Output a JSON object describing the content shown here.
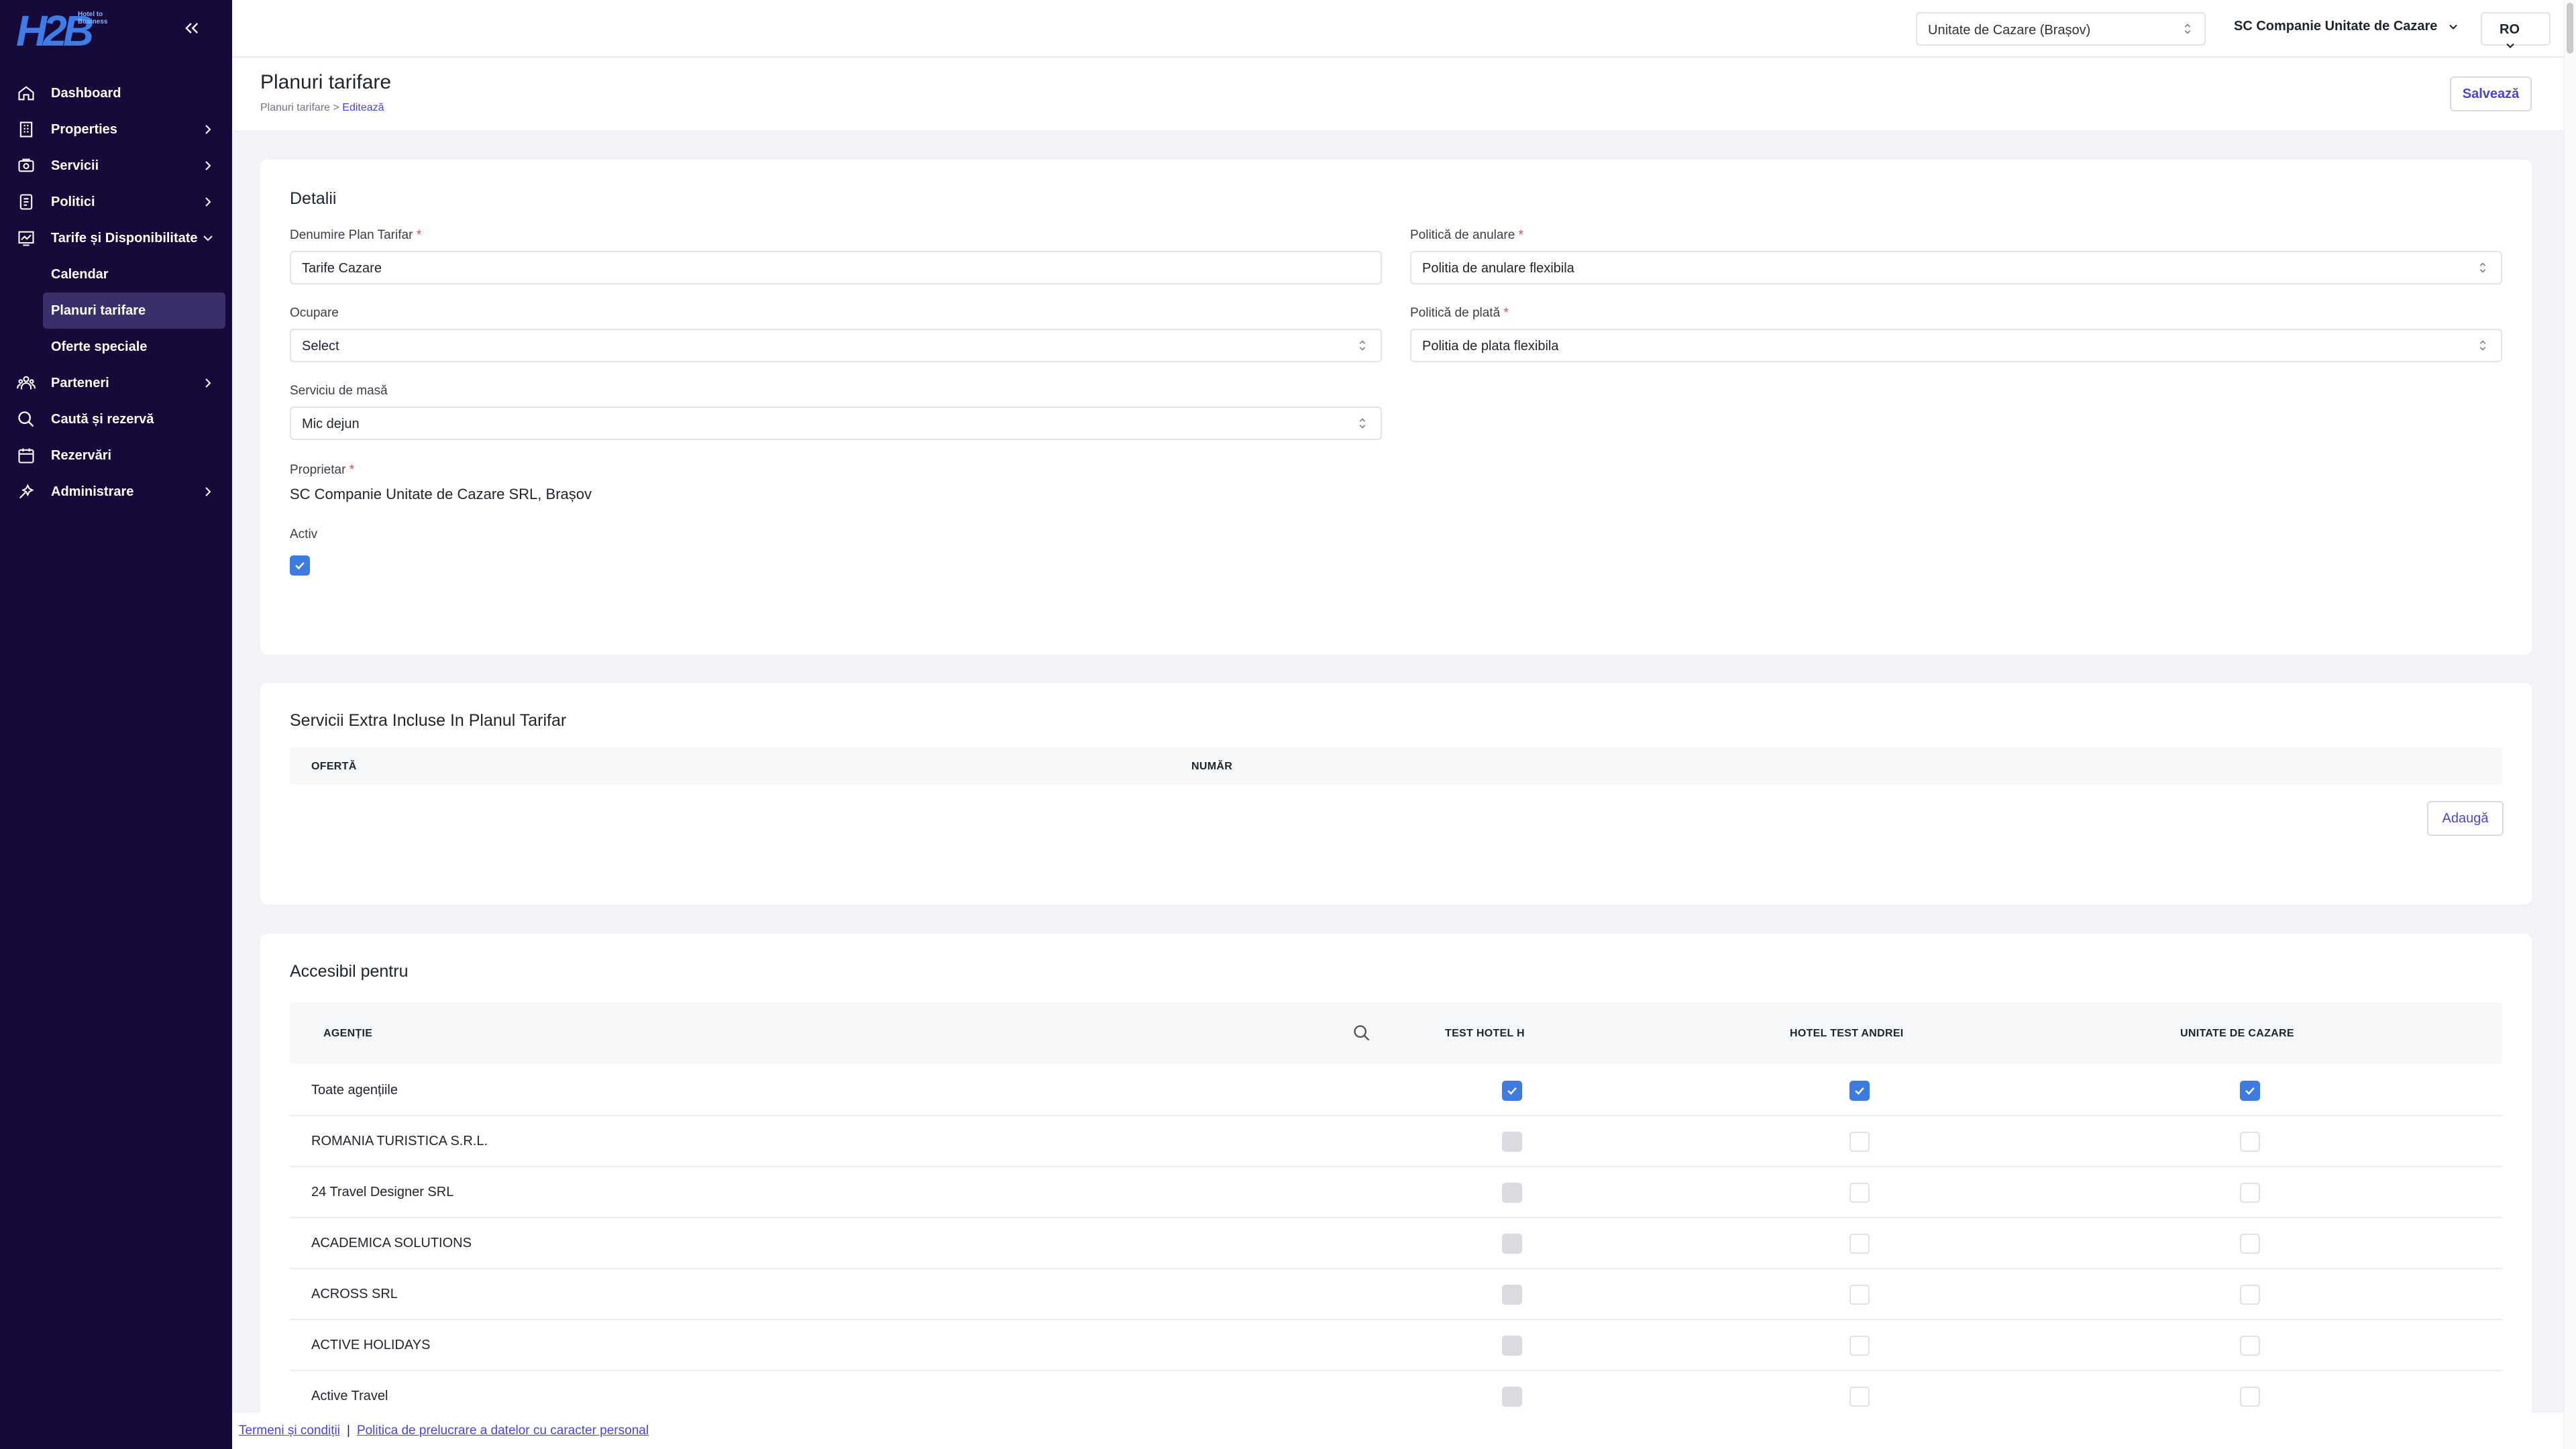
{
  "brand": {
    "logo_mark": "H2B",
    "logo_text": "Hotel to Business"
  },
  "sidebar": {
    "items": [
      {
        "label": "Dashboard",
        "icon": "home-icon"
      },
      {
        "label": "Properties",
        "icon": "building-icon"
      },
      {
        "label": "Servicii",
        "icon": "services-icon"
      },
      {
        "label": "Politici",
        "icon": "document-icon"
      },
      {
        "label": "Tarife și Disponibilitate",
        "icon": "chart-icon"
      },
      {
        "label": "Parteneri",
        "icon": "partners-icon"
      },
      {
        "label": "Caută și rezervă",
        "icon": "search-icon"
      },
      {
        "label": "Rezervări",
        "icon": "calendar-icon"
      },
      {
        "label": "Administrare",
        "icon": "admin-icon"
      }
    ],
    "sub_items": [
      "Calendar",
      "Planuri tarifare",
      "Oferte speciale"
    ]
  },
  "topbar": {
    "unit_select": "Unitate de Cazare (Brașov)",
    "company": "SC Companie Unitate de Cazare",
    "language": "RO"
  },
  "page": {
    "title": "Planuri tarifare",
    "breadcrumb_root": "Planuri tarifare",
    "breadcrumb_sep": ">",
    "breadcrumb_current": "Editează",
    "save_label": "Salvează"
  },
  "details": {
    "title": "Detalii",
    "plan_name_label": "Denumire Plan Tarifar",
    "plan_name_value": "Tarife Cazare",
    "cancel_policy_label": "Politică de anulare",
    "cancel_policy_value": "Politia de anulare flexibila",
    "occupancy_label": "Ocupare",
    "occupancy_value": "Select",
    "payment_policy_label": "Politică de plată",
    "payment_policy_value": "Politia de plata flexibila",
    "meal_label": "Serviciu de masă",
    "meal_value": "Mic dejun",
    "owner_label": "Proprietar",
    "owner_value": "SC Companie Unitate de Cazare SRL, Brașov",
    "active_label": "Activ",
    "required_mark": "*"
  },
  "extras": {
    "title": "Servicii Extra Incluse In Planul Tarifar",
    "col_offer": "OFERTĂ",
    "col_number": "NUMĂR",
    "add_label": "Adaugă"
  },
  "access": {
    "title": "Accesibil pentru",
    "col_agency": "AGENȚIE",
    "columns": [
      "TEST HOTEL H",
      "HOTEL TEST ANDREI",
      "UNITATE DE CAZARE"
    ],
    "rows": [
      {
        "name": "Toate agențiile",
        "states": [
          "on",
          "on",
          "on"
        ]
      },
      {
        "name": "ROMANIA TURISTICA S.R.L.",
        "states": [
          "dis",
          "off",
          "off"
        ]
      },
      {
        "name": "24 Travel Designer SRL",
        "states": [
          "dis",
          "off",
          "off"
        ]
      },
      {
        "name": "ACADEMICA SOLUTIONS",
        "states": [
          "dis",
          "off",
          "off"
        ]
      },
      {
        "name": "ACROSS SRL",
        "states": [
          "dis",
          "off",
          "off"
        ]
      },
      {
        "name": "ACTIVE HOLIDAYS",
        "states": [
          "dis",
          "off",
          "off"
        ]
      },
      {
        "name": "Active Travel",
        "states": [
          "dis",
          "off",
          "off"
        ]
      }
    ]
  },
  "footer": {
    "terms": "Termeni și condiții",
    "separator": "|",
    "privacy": "Politica de prelucrare a datelor cu caracter personal"
  },
  "colors": {
    "sidebar_bg": "#150a3a",
    "accent": "#4b44d1",
    "checkbox_on": "#3d7be0"
  }
}
